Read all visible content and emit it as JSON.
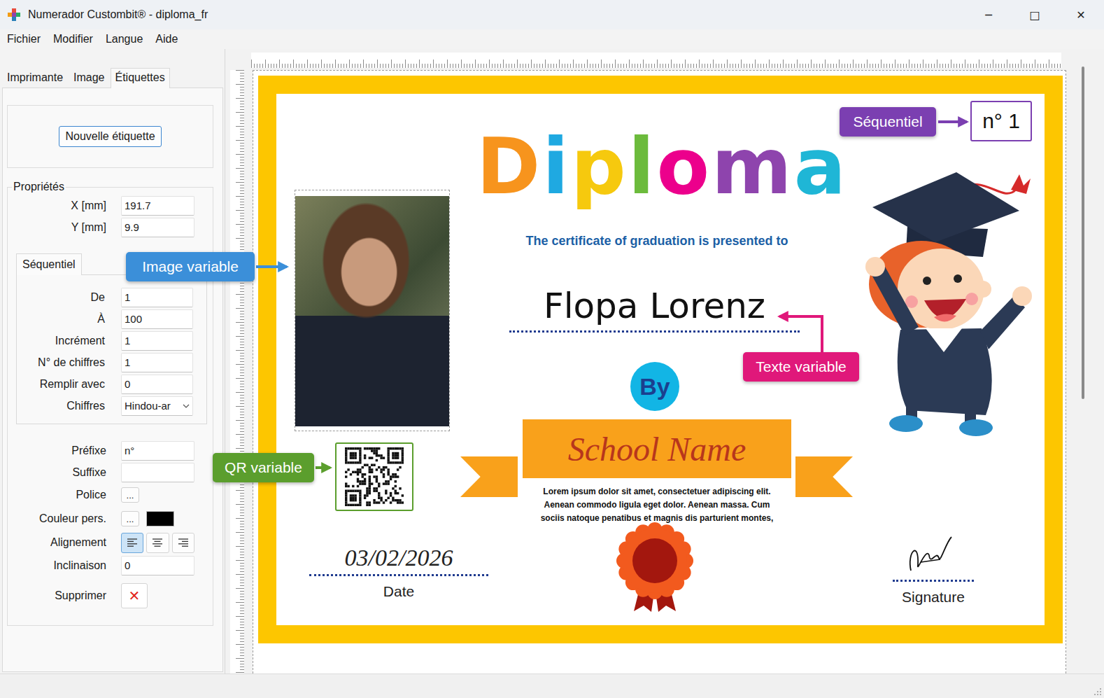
{
  "window": {
    "title": "Numerador Custombit® - diploma_fr",
    "controls": [
      "─",
      "□",
      "✕"
    ]
  },
  "menu": [
    {
      "label": "Fichier"
    },
    {
      "label": "Modifier"
    },
    {
      "label": "Langue"
    },
    {
      "label": "Aide"
    }
  ],
  "tabs": [
    {
      "label": "Imprimante",
      "selected": false
    },
    {
      "label": "Image",
      "selected": false
    },
    {
      "label": "Étiquettes",
      "selected": true
    }
  ],
  "new_label_button": "Nouvelle étiquette",
  "properties": {
    "title": "Propriétés",
    "position": [
      {
        "label": "X [mm]",
        "value": "191.7"
      },
      {
        "label": "Y [mm]",
        "value": "9.9"
      }
    ],
    "subtab": {
      "label": "Séquentiel",
      "selected": true
    },
    "sequence": [
      {
        "label": "De",
        "value": "1",
        "kind": "input"
      },
      {
        "label": "À",
        "value": "100",
        "kind": "input"
      },
      {
        "label": "Incrément",
        "value": "1",
        "kind": "input"
      },
      {
        "label": "N° de chiffres",
        "value": "1",
        "kind": "input"
      },
      {
        "label": "Remplir avec",
        "value": "0",
        "kind": "input"
      },
      {
        "label": "Chiffres",
        "value": "Hindou-ar",
        "kind": "select"
      }
    ],
    "format": [
      {
        "label": "Préfixe",
        "kind": "input",
        "value": "n°"
      },
      {
        "label": "Suffixe",
        "kind": "input",
        "value": ""
      },
      {
        "label": "Police",
        "kind": "button",
        "value": "..."
      },
      {
        "label": "Couleur pers.",
        "kind": "color",
        "value": "...",
        "color": "#000000"
      },
      {
        "label": "Alignement",
        "kind": "align",
        "options": [
          {
            "selected": true
          },
          {
            "selected": false
          },
          {
            "selected": false
          }
        ]
      },
      {
        "label": "Inclinaison",
        "kind": "input",
        "value": "0"
      },
      {
        "label": "Supprimer",
        "kind": "delete",
        "value": "✕"
      }
    ]
  },
  "diploma": {
    "title_letters": [
      {
        "text": "D",
        "color": "#f7941d"
      },
      {
        "text": "i",
        "color": "#1fa9e1"
      },
      {
        "text": "p",
        "color": "#f6c90e"
      },
      {
        "text": "l",
        "color": "#6cbb3c"
      },
      {
        "text": "o",
        "color": "#ec008c"
      },
      {
        "text": "m",
        "color": "#8e44ad"
      },
      {
        "text": "a",
        "color": "#1fb6d6"
      }
    ],
    "subtitle": "The certificate of graduation is presented to",
    "recipient": "Flopa Lorenz",
    "by": "By",
    "school": "School Name",
    "description": [
      "Lorem ipsum dolor sit amet, consectetuer adipiscing elit.",
      "Aenean commodo ligula eget dolor. Aenean massa. Cum",
      "sociis natoque penatibus et magnis dis parturient montes,"
    ],
    "date": "03/02/2026",
    "date_label": "Date",
    "signature_label": "Signature",
    "sequence_number": "n° 1"
  },
  "annotations": [
    {
      "text": "Séquentiel",
      "color": "#7b3fb1"
    },
    {
      "text": "Image variable",
      "color": "#3b8fd9"
    },
    {
      "text": "Texte variable",
      "color": "#e0187a"
    },
    {
      "text": "QR variable",
      "color": "#5b9e2d"
    }
  ]
}
